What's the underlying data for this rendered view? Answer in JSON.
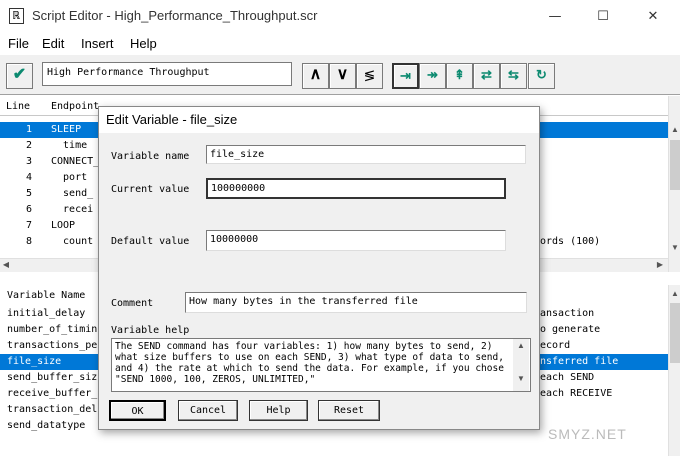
{
  "window": {
    "title": "Script Editor - High_Performance_Throughput.scr",
    "app_icon_glyph": "ℝ",
    "minimize": "—",
    "maximize": "☐",
    "close": "✕"
  },
  "menu": [
    "File",
    "Edit",
    "Insert",
    "Help"
  ],
  "toolbar": {
    "script_name": "High Performance Throughput",
    "check_glyph": "✔",
    "up_glyph": "∧",
    "down_glyph": "∨",
    "swap_glyph": "≶",
    "g1": "⇥",
    "g2": "↠",
    "g3": "⇞",
    "g4": "⇄",
    "g5": "⇆",
    "g6": "↻"
  },
  "script": {
    "col_line": "Line",
    "col_endpoint": "Endpoint",
    "rows": [
      {
        "line": "1",
        "text": "SLEEP"
      },
      {
        "line": "2",
        "text": "  time"
      },
      {
        "line": "3",
        "text": "CONNECT_"
      },
      {
        "line": "4",
        "text": "  port"
      },
      {
        "line": "5",
        "text": "  send_"
      },
      {
        "line": "6",
        "text": "  recei"
      },
      {
        "line": "7",
        "text": "LOOP"
      },
      {
        "line": "8",
        "text": "  count"
      }
    ],
    "right_fragments": [
      "ords (100)"
    ]
  },
  "variables": {
    "col_name": "Variable Name",
    "rows": [
      "initial_delay",
      "number_of_timin",
      "transactions_pe",
      "file_size",
      "send_buffer_siz",
      "receive_buffer_",
      "transaction_del",
      "send_datatype"
    ],
    "right_fragments": [
      "ansaction",
      "o generate",
      "ecord",
      "nsferred file",
      "each SEND",
      "each RECEIVE",
      "",
      ""
    ]
  },
  "dialog": {
    "title": "Edit Variable - file_size",
    "name_label": "Variable name",
    "name_value": "file_size",
    "current_label": "Current value",
    "current_value": "100000000",
    "default_label": "Default value",
    "default_value": "10000000",
    "comment_label": "Comment",
    "comment_value": "How many bytes in the transferred file",
    "help_label": "Variable help",
    "help_text": "The SEND command has four variables: 1) how many bytes to send, 2) what size buffers to use on each SEND, 3) what type of data to send, and 4) the rate at which to send the data. For example, if you chose \"SEND 1000, 100, ZEROS, UNLIMITED,\"",
    "ok": "OK",
    "cancel": "Cancel",
    "help": "Help",
    "reset": "Reset"
  },
  "watermark": "SMYZ.NET"
}
